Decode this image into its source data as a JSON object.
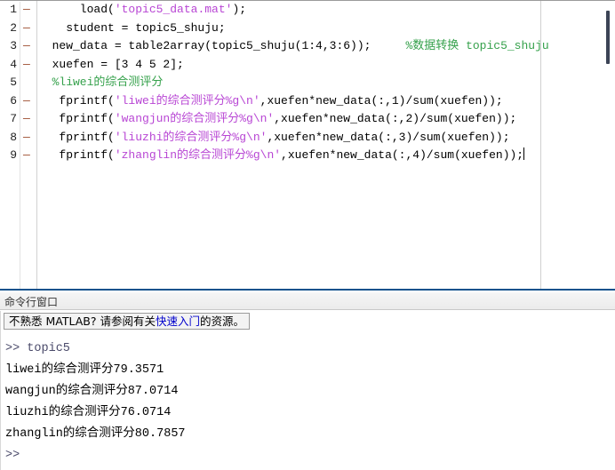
{
  "editor": {
    "gutter_dash": "—",
    "lines": [
      {
        "num": "1",
        "marked": true,
        "segments": [
          {
            "cls": "tok-plain",
            "text": "      load("
          },
          {
            "cls": "tok-str",
            "text": "'topic5_data.mat'"
          },
          {
            "cls": "tok-plain",
            "text": ");"
          }
        ]
      },
      {
        "num": "2",
        "marked": true,
        "segments": [
          {
            "cls": "tok-plain",
            "text": "    student = topic5_shuju;"
          }
        ]
      },
      {
        "num": "3",
        "marked": true,
        "segments": [
          {
            "cls": "tok-plain",
            "text": "  new_data = table2array(topic5_shuju(1:4,3:6));     "
          },
          {
            "cls": "tok-com",
            "text": "%数据转换 topic5_shuju"
          }
        ]
      },
      {
        "num": "4",
        "marked": true,
        "segments": [
          {
            "cls": "tok-plain",
            "text": "  xuefen = [3 4 5 2];"
          }
        ]
      },
      {
        "num": "5",
        "marked": false,
        "segments": [
          {
            "cls": "tok-com",
            "text": "  %liwei的综合测评分"
          }
        ]
      },
      {
        "num": "6",
        "marked": true,
        "segments": [
          {
            "cls": "tok-plain",
            "text": "   fprintf("
          },
          {
            "cls": "tok-str",
            "text": "'liwei的综合测评分%g\\n'"
          },
          {
            "cls": "tok-plain",
            "text": ",xuefen*new_data(:,1)/sum(xuefen));"
          }
        ]
      },
      {
        "num": "7",
        "marked": true,
        "segments": [
          {
            "cls": "tok-plain",
            "text": "   fprintf("
          },
          {
            "cls": "tok-str",
            "text": "'wangjun的综合测评分%g\\n'"
          },
          {
            "cls": "tok-plain",
            "text": ",xuefen*new_data(:,2)/sum(xuefen));"
          }
        ]
      },
      {
        "num": "8",
        "marked": true,
        "segments": [
          {
            "cls": "tok-plain",
            "text": "   fprintf("
          },
          {
            "cls": "tok-str",
            "text": "'liuzhi的综合测评分%g\\n'"
          },
          {
            "cls": "tok-plain",
            "text": ",xuefen*new_data(:,3)/sum(xuefen));"
          }
        ]
      },
      {
        "num": "9",
        "marked": true,
        "segments": [
          {
            "cls": "tok-plain",
            "text": "   fprintf("
          },
          {
            "cls": "tok-str",
            "text": "'zhanglin的综合测评分%g\\n'"
          },
          {
            "cls": "tok-plain",
            "text": ",xuefen*new_data(:,4)/sum(xuefen));"
          }
        ]
      }
    ]
  },
  "command_window": {
    "title": "命令行窗口",
    "hint": {
      "before": "不熟悉 MATLAB? 请参阅有关",
      "link": "快速入门",
      "after": "的资源。"
    },
    "output_lines": [
      ">> topic5",
      "liwei的综合测评分79.3571",
      "wangjun的综合测评分87.0714",
      "liuzhi的综合测评分76.0714",
      "zhanglin的综合测评分80.7857",
      ">>"
    ]
  },
  "colors": {
    "string": "#b846d4",
    "comment": "#35a14b",
    "link": "#0000cc",
    "panel_border": "#14528c"
  }
}
